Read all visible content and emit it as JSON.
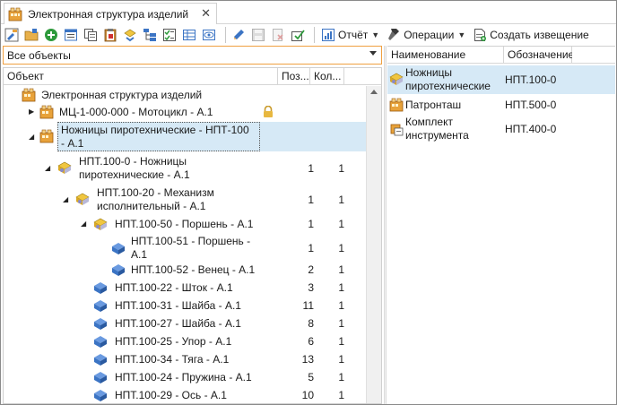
{
  "tab": {
    "title": "Электронная структура изделий",
    "close": "✕"
  },
  "toolbar": {
    "report_label": "Отчёт",
    "operations_label": "Операции",
    "create_notice_label": "Создать извещение"
  },
  "filter": {
    "value": "Все объекты"
  },
  "tree": {
    "columns": {
      "object": "Объект",
      "pos": "Поз...",
      "qty": "Кол..."
    },
    "rows": [
      {
        "text": "Электронная структура изделий",
        "pos": "",
        "qty": ""
      },
      {
        "text": "МЦ-1-000-000 - Мотоцикл - А.1",
        "pos": "",
        "qty": ""
      },
      {
        "text1": "Ножницы пиротехнические - НПТ-100",
        "text2": "- А.1",
        "pos": "",
        "qty": ""
      },
      {
        "text1": "НПТ.100-0 - Ножницы",
        "text2": "пиротехнические - А.1",
        "pos": "1",
        "qty": "1"
      },
      {
        "text1": "НПТ.100-20 - Механизм",
        "text2": "исполнительный - А.1",
        "pos": "1",
        "qty": "1"
      },
      {
        "text": "НПТ.100-50 - Поршень - А.1",
        "pos": "1",
        "qty": "1"
      },
      {
        "text1": "НПТ.100-51 - Поршень -",
        "text2": "А.1",
        "pos": "1",
        "qty": "1"
      },
      {
        "text": "НПТ.100-52 - Венец - А.1",
        "pos": "2",
        "qty": "1"
      },
      {
        "text": "НПТ.100-22 - Шток - А.1",
        "pos": "3",
        "qty": "1"
      },
      {
        "text": "НПТ.100-31 - Шайба - А.1",
        "pos": "11",
        "qty": "1"
      },
      {
        "text": "НПТ.100-27 - Шайба - А.1",
        "pos": "8",
        "qty": "1"
      },
      {
        "text": "НПТ.100-25 - Упор - А.1",
        "pos": "6",
        "qty": "1"
      },
      {
        "text": "НПТ.100-34 - Тяга - А.1",
        "pos": "13",
        "qty": "1"
      },
      {
        "text": "НПТ.100-24 - Пружина - А.1",
        "pos": "5",
        "qty": "1"
      },
      {
        "text": "НПТ.100-29 - Ось - А.1",
        "pos": "10",
        "qty": "1"
      }
    ]
  },
  "list": {
    "columns": {
      "name": "Наименование",
      "code": "Обозначение"
    },
    "rows": [
      {
        "name1": "Ножницы",
        "name2": "пиротехнические",
        "code": "НПТ.100-0"
      },
      {
        "name1": "Патронташ",
        "name2": "",
        "code": "НПТ.500-0"
      },
      {
        "name1": "Комплект",
        "name2": "инструмента",
        "code": "НПТ.400-0"
      }
    ]
  },
  "colors": {
    "selection": "#d6e9f6",
    "combo_border": "#f0a040",
    "folder": "#e8a23a",
    "part_blue": "#3b74c4",
    "assembly_yellow": "#f0c640"
  }
}
